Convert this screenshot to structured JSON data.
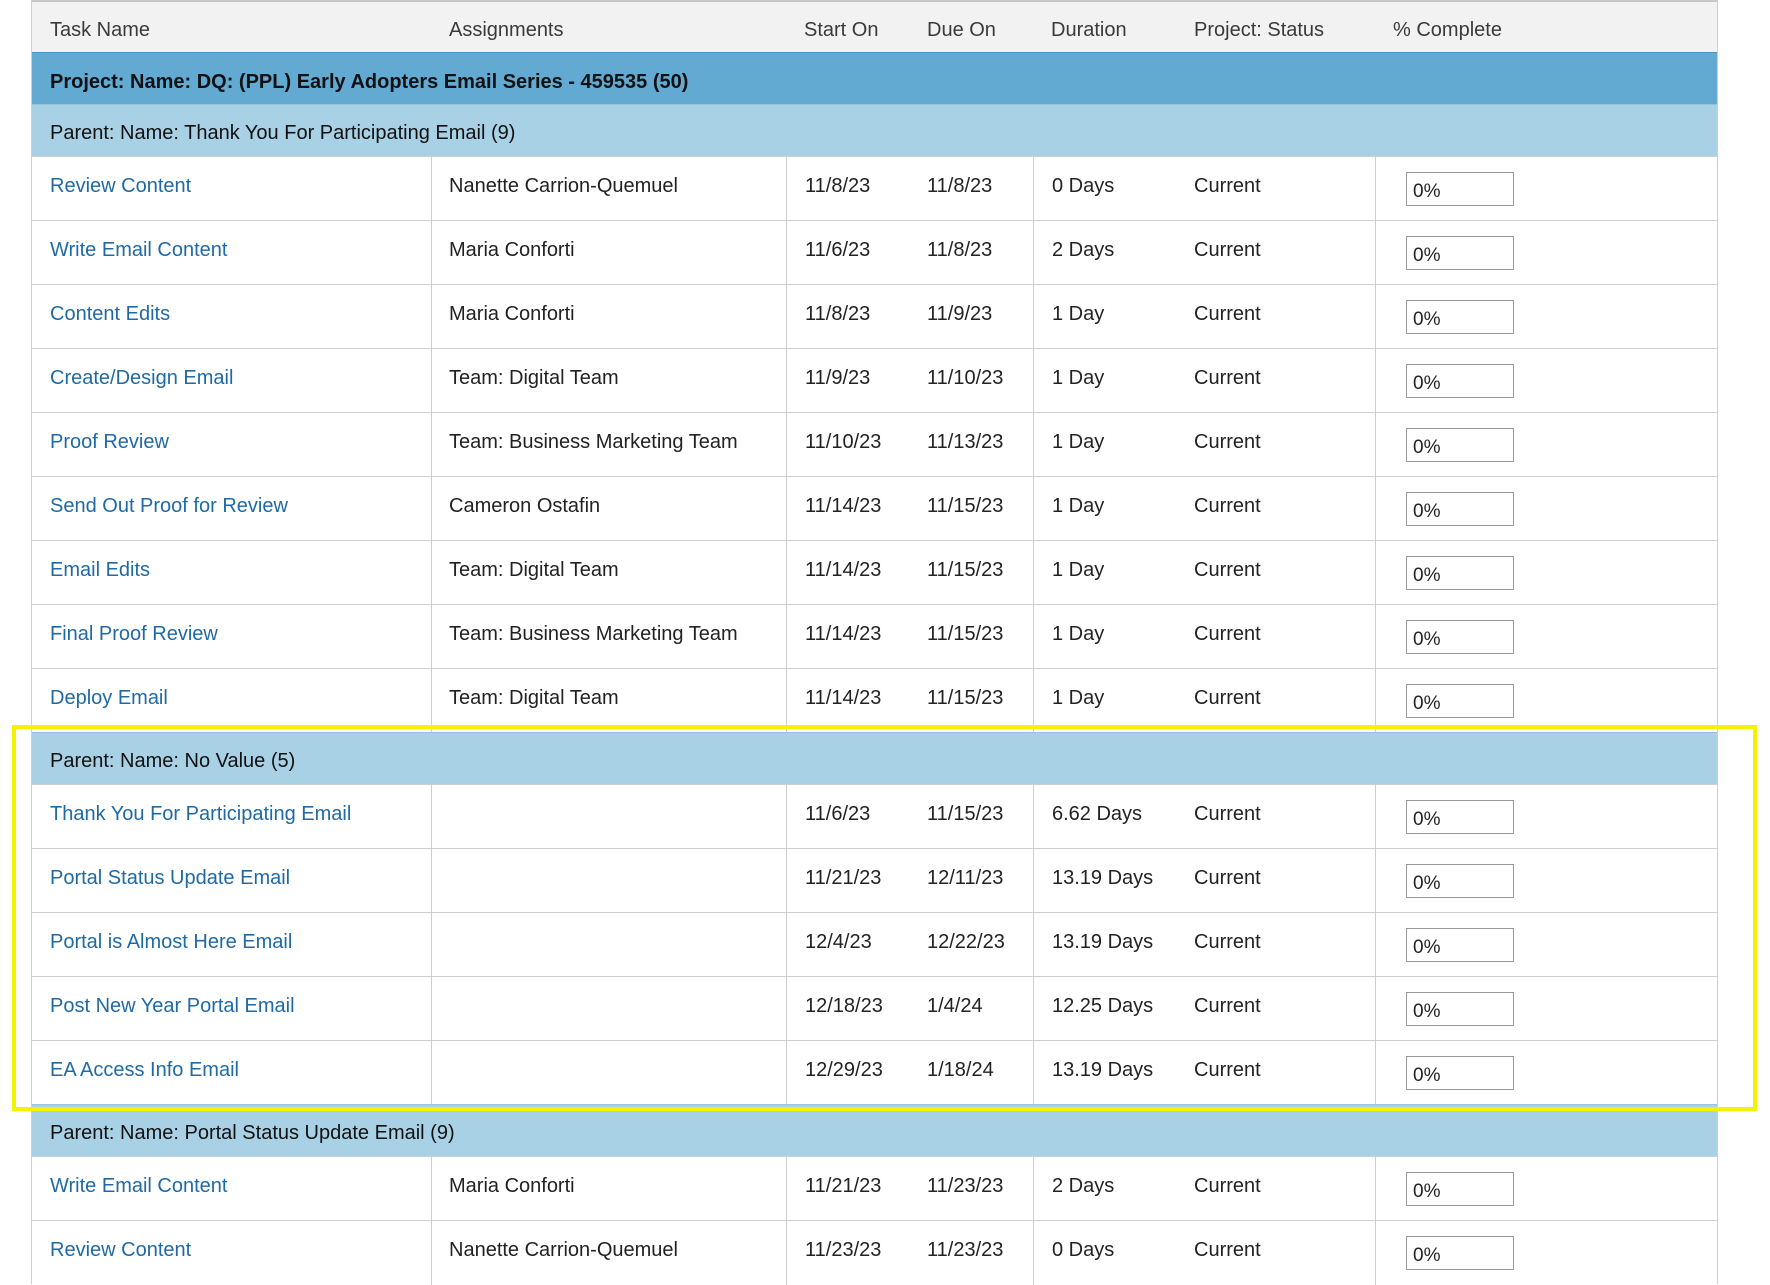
{
  "headers": {
    "task_name": "Task Name",
    "assignments": "Assignments",
    "start_on": "Start On",
    "due_on": "Due On",
    "duration": "Duration",
    "project_status": "Project: Status",
    "percent_complete": "% Complete"
  },
  "project_label": "Project: Name: DQ: (PPL) Early Adopters Email Series - 459535 (50)",
  "groups": [
    {
      "label": "Parent: Name: Thank You For Participating Email (9)",
      "tasks": [
        {
          "name": "Review Content",
          "assignment": "Nanette Carrion-Quemuel",
          "start": "11/8/23",
          "due": "11/8/23",
          "duration": "0 Days",
          "status": "Current",
          "pct": "0%"
        },
        {
          "name": "Write Email Content",
          "assignment": "Maria Conforti",
          "start": "11/6/23",
          "due": "11/8/23",
          "duration": "2 Days",
          "status": "Current",
          "pct": "0%"
        },
        {
          "name": "Content Edits",
          "assignment": "Maria Conforti",
          "start": "11/8/23",
          "due": "11/9/23",
          "duration": "1 Day",
          "status": "Current",
          "pct": "0%"
        },
        {
          "name": "Create/Design Email",
          "assignment": "Team: Digital Team",
          "start": "11/9/23",
          "due": "11/10/23",
          "duration": "1 Day",
          "status": "Current",
          "pct": "0%"
        },
        {
          "name": "Proof Review",
          "assignment": "Team: Business Marketing Team",
          "start": "11/10/23",
          "due": "11/13/23",
          "duration": "1 Day",
          "status": "Current",
          "pct": "0%"
        },
        {
          "name": "Send Out Proof for Review",
          "assignment": "Cameron Ostafin",
          "start": "11/14/23",
          "due": "11/15/23",
          "duration": "1 Day",
          "status": "Current",
          "pct": "0%"
        },
        {
          "name": "Email Edits",
          "assignment": "Team: Digital Team",
          "start": "11/14/23",
          "due": "11/15/23",
          "duration": "1 Day",
          "status": "Current",
          "pct": "0%"
        },
        {
          "name": "Final Proof Review",
          "assignment": "Team: Business Marketing Team",
          "start": "11/14/23",
          "due": "11/15/23",
          "duration": "1 Day",
          "status": "Current",
          "pct": "0%"
        },
        {
          "name": "Deploy Email",
          "assignment": "Team: Digital Team",
          "start": "11/14/23",
          "due": "11/15/23",
          "duration": "1 Day",
          "status": "Current",
          "pct": "0%"
        }
      ]
    },
    {
      "label": "Parent: Name: No Value (5)",
      "highlighted": true,
      "tasks": [
        {
          "name": "Thank You For Participating Email",
          "assignment": "",
          "start": "11/6/23",
          "due": "11/15/23",
          "duration": "6.62 Days",
          "status": "Current",
          "pct": "0%"
        },
        {
          "name": "Portal Status Update Email",
          "assignment": "",
          "start": "11/21/23",
          "due": "12/11/23",
          "duration": "13.19 Days",
          "status": "Current",
          "pct": "0%"
        },
        {
          "name": "Portal is Almost Here Email",
          "assignment": "",
          "start": "12/4/23",
          "due": "12/22/23",
          "duration": "13.19 Days",
          "status": "Current",
          "pct": "0%"
        },
        {
          "name": "Post New Year Portal Email",
          "assignment": "",
          "start": "12/18/23",
          "due": "1/4/24",
          "duration": "12.25 Days",
          "status": "Current",
          "pct": "0%"
        },
        {
          "name": "EA Access Info Email",
          "assignment": "",
          "start": "12/29/23",
          "due": "1/18/24",
          "duration": "13.19 Days",
          "status": "Current",
          "pct": "0%"
        }
      ]
    },
    {
      "label": "Parent: Name: Portal Status Update Email (9)",
      "tasks": [
        {
          "name": "Write Email Content",
          "assignment": "Maria Conforti",
          "start": "11/21/23",
          "due": "11/23/23",
          "duration": "2 Days",
          "status": "Current",
          "pct": "0%"
        },
        {
          "name": "Review Content",
          "assignment": "Nanette Carrion-Quemuel",
          "start": "11/23/23",
          "due": "11/23/23",
          "duration": "0 Days",
          "status": "Current",
          "pct": "0%"
        }
      ]
    }
  ],
  "colors": {
    "project_row": "#63aad3",
    "parent_row": "#a8d1e6",
    "link": "#1f6aa5",
    "highlight": "#f5f200"
  }
}
